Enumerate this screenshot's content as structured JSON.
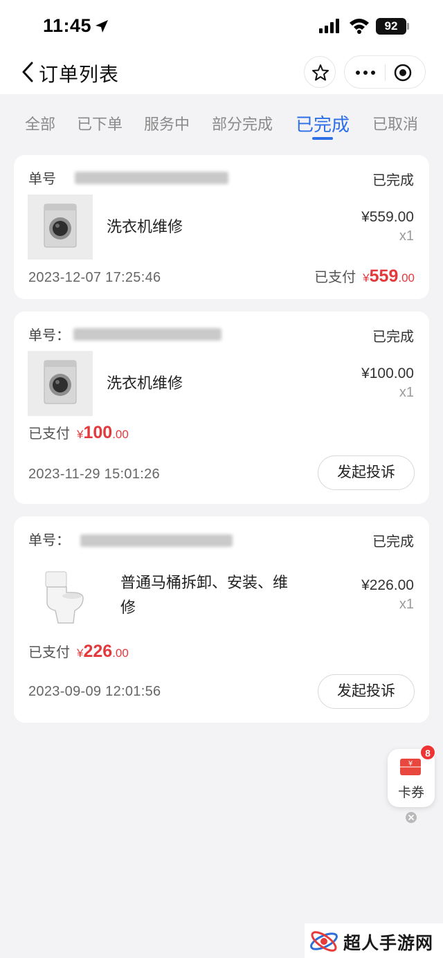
{
  "status_bar": {
    "time": "11:45",
    "battery": "92"
  },
  "nav": {
    "title": "订单列表"
  },
  "tabs": [
    {
      "label": "全部",
      "active": false
    },
    {
      "label": "已下单",
      "active": false
    },
    {
      "label": "服务中",
      "active": false
    },
    {
      "label": "部分完成",
      "active": false
    },
    {
      "label": "已完成",
      "active": true
    },
    {
      "label": "已取消",
      "active": false
    }
  ],
  "orders": [
    {
      "order_no_label": "单号",
      "status": "已完成",
      "item_name": "洗衣机维修",
      "item_price": "¥559.00",
      "item_qty": "x1",
      "time": "2023-12-07 17:25:46",
      "paid_label": "已支付",
      "paid_currency": "¥",
      "paid_int": "559",
      "paid_dec": ".00",
      "thumb_icon": "washing-machine-icon"
    },
    {
      "order_no_label": "单号：",
      "status": "已完成",
      "item_name": "洗衣机维修",
      "item_price": "¥100.00",
      "item_qty": "x1",
      "time": "2023-11-29 15:01:26",
      "paid_label": "已支付",
      "paid_currency": "¥",
      "paid_int": "100",
      "paid_dec": ".00",
      "action_label": "发起投诉",
      "thumb_icon": "washing-machine-icon"
    },
    {
      "order_no_label": "单号：",
      "status": "已完成",
      "item_name_line1": "普通马桶拆卸、安装、维",
      "item_name_line2": "修",
      "item_price": "¥226.00",
      "item_qty": "x1",
      "time": "2023-09-09 12:01:56",
      "paid_label": "已支付",
      "paid_currency": "¥",
      "paid_int": "226",
      "paid_dec": ".00",
      "action_label": "发起投诉",
      "thumb_icon": "toilet-icon"
    }
  ],
  "coupon": {
    "label": "卡券",
    "badge": "8",
    "icon": "coupon-icon"
  },
  "watermark": {
    "text": "超人手游网"
  },
  "colors": {
    "accent": "#2c6fe6",
    "price_red": "#e4393c",
    "background": "#f3f3f5"
  }
}
